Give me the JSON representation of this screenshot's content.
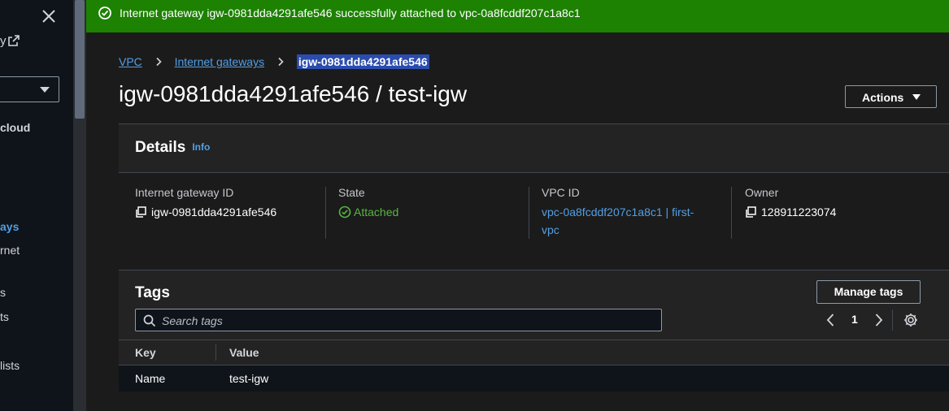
{
  "sidebar": {
    "ext_link_fragment": "y",
    "items": [
      {
        "label": "cloud",
        "style": "bold"
      },
      {
        "label": "ays",
        "style": "active"
      },
      {
        "label": "rnet",
        "style": "normal"
      },
      {
        "label": "s",
        "style": "normal"
      },
      {
        "label": "ts",
        "style": "normal"
      },
      {
        "label": "lists",
        "style": "normal"
      }
    ]
  },
  "flash": {
    "message": "Internet gateway igw-0981dda4291afe546 successfully attached to vpc-0a8fcddf207c1a8c1",
    "color": "#1d8102"
  },
  "breadcrumb": {
    "items": [
      "VPC",
      "Internet gateways"
    ],
    "current": "igw-0981dda4291afe546"
  },
  "page": {
    "title": "igw-0981dda4291afe546 / test-igw",
    "actions_label": "Actions"
  },
  "details": {
    "title": "Details",
    "info_label": "Info",
    "columns": {
      "gateway_id": {
        "label": "Internet gateway ID",
        "value": "igw-0981dda4291afe546"
      },
      "state": {
        "label": "State",
        "value": "Attached"
      },
      "vpc_id": {
        "label": "VPC ID",
        "value_line1": "vpc-0a8fcddf207c1a8c1 | first-",
        "value_line2": "vpc"
      },
      "owner": {
        "label": "Owner",
        "value": "128911223074"
      }
    }
  },
  "tags": {
    "title": "Tags",
    "manage_label": "Manage tags",
    "search_placeholder": "Search tags",
    "page_number": "1",
    "columns": [
      "Key",
      "Value"
    ],
    "rows": [
      {
        "key": "Name",
        "value": "test-igw"
      }
    ]
  },
  "colors": {
    "accent_link": "#539fe5",
    "success": "#59b543",
    "background": "#1b1b1b"
  }
}
